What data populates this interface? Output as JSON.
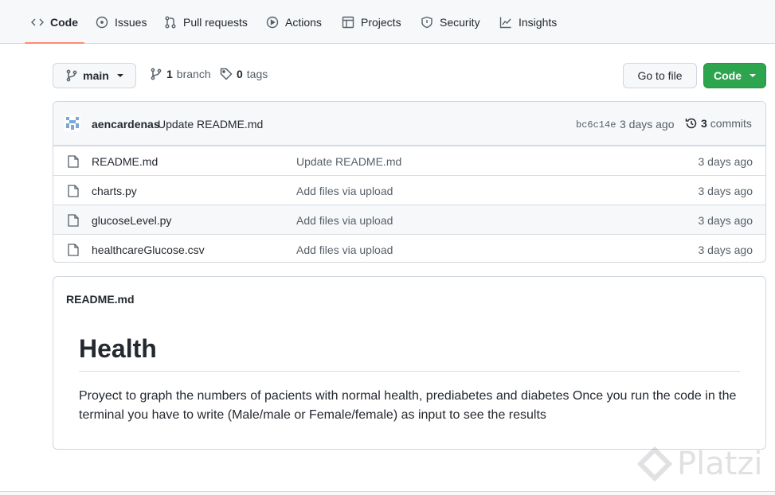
{
  "nav": {
    "tabs": [
      {
        "label": "Code",
        "icon": "code-icon"
      },
      {
        "label": "Issues",
        "icon": "issue-icon"
      },
      {
        "label": "Pull requests",
        "icon": "pull-request-icon"
      },
      {
        "label": "Actions",
        "icon": "play-icon"
      },
      {
        "label": "Projects",
        "icon": "table-icon"
      },
      {
        "label": "Security",
        "icon": "shield-icon"
      },
      {
        "label": "Insights",
        "icon": "graph-icon"
      }
    ]
  },
  "branch_bar": {
    "branch_name": "main",
    "branch_count": "1",
    "branch_label": "branch",
    "tag_count": "0",
    "tag_label": "tags",
    "go_to_file_label": "Go to file",
    "code_button_label": "Code"
  },
  "latest_commit": {
    "author": "aencardenas",
    "message": "Update README.md",
    "sha": "bc6c14e",
    "time": "3 days ago",
    "commit_count": "3",
    "commit_label": "commits"
  },
  "files": [
    {
      "name": "README.md",
      "message": "Update README.md",
      "time": "3 days ago"
    },
    {
      "name": "charts.py",
      "message": "Add files via upload",
      "time": "3 days ago"
    },
    {
      "name": "glucoseLevel.py",
      "message": "Add files via upload",
      "time": "3 days ago"
    },
    {
      "name": "healthcareGlucose.csv",
      "message": "Add files via upload",
      "time": "3 days ago"
    }
  ],
  "readme": {
    "file_name": "README.md",
    "heading": "Health",
    "body": "Proyect to graph the numbers of pacients with normal health, prediabetes and diabetes Once you run the code in the terminal you have to write (Male/male or Female/female) as input to see the results"
  },
  "watermark": "Platzi",
  "colors": {
    "accent_underline": "#fd8c73",
    "green_button": "#2da44e",
    "border": "#d0d7de"
  }
}
